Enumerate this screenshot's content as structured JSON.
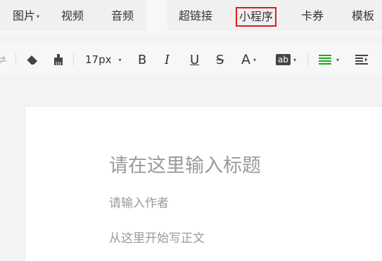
{
  "insert_tabs": {
    "image": "图片",
    "video": "视频",
    "audio": "音频",
    "hyperlink": "超链接",
    "mini_program": "小程序",
    "coupon": "卡券",
    "template": "模板"
  },
  "toolbar": {
    "font_size": "17px",
    "bold": "B",
    "italic": "I",
    "underline": "U",
    "strike": "S",
    "font_color": "A",
    "bg_color": "ab"
  },
  "editor": {
    "title_placeholder": "请在这里输入标题",
    "author_placeholder": "请输入作者",
    "body_placeholder": "从这里开始写正文"
  },
  "colors": {
    "highlight_border": "#e01b1b",
    "align_icon": "#1aad19"
  }
}
